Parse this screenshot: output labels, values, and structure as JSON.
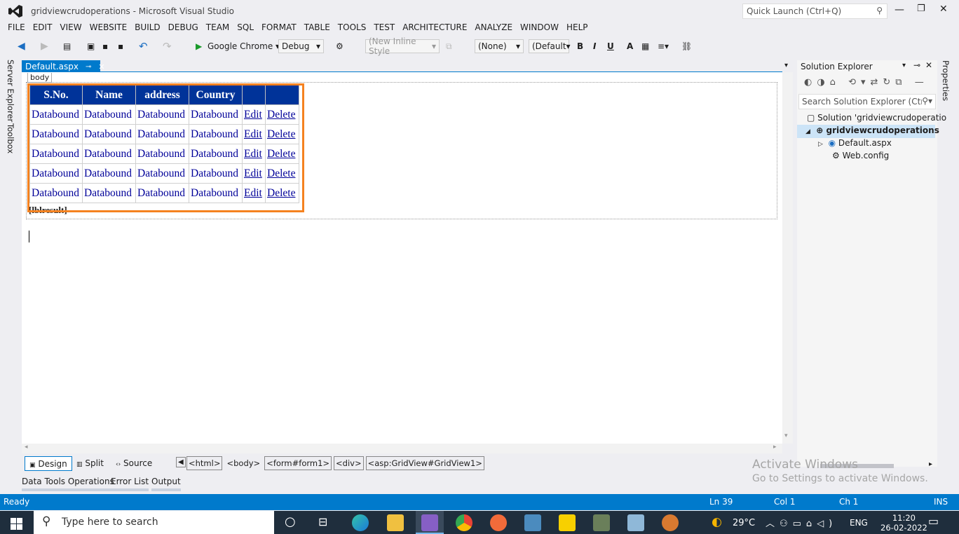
{
  "window": {
    "title": "gridviewcrudoperations - Microsoft Visual Studio",
    "quick_launch": "Quick Launch (Ctrl+Q)"
  },
  "menu": [
    "FILE",
    "EDIT",
    "VIEW",
    "WEBSITE",
    "BUILD",
    "DEBUG",
    "TEAM",
    "SQL",
    "FORMAT",
    "TABLE",
    "TOOLS",
    "TEST",
    "ARCHITECTURE",
    "ANALYZE",
    "WINDOW",
    "HELP"
  ],
  "toolbar": {
    "browser": "Google Chrome",
    "config": "Debug",
    "style": "(New Inline Style",
    "target": "(None)",
    "font": "(Default",
    "bold": "B",
    "italic": "I",
    "underline": "U"
  },
  "side_tabs": {
    "server_explorer": "Server Explorer",
    "toolbox": "Toolbox",
    "properties": "Properties"
  },
  "doc_tab": {
    "name": "Default.aspx",
    "pin": "⊸",
    "close": "✕"
  },
  "designer": {
    "body_tag": "body",
    "label_text": "[lblresult]"
  },
  "grid": {
    "headers": [
      "S.No.",
      "Name",
      "address",
      "Country",
      "",
      ""
    ],
    "rows": [
      [
        "Databound",
        "Databound",
        "Databound",
        "Databound",
        "Edit",
        "Delete"
      ],
      [
        "Databound",
        "Databound",
        "Databound",
        "Databound",
        "Edit",
        "Delete"
      ],
      [
        "Databound",
        "Databound",
        "Databound",
        "Databound",
        "Edit",
        "Delete"
      ],
      [
        "Databound",
        "Databound",
        "Databound",
        "Databound",
        "Edit",
        "Delete"
      ],
      [
        "Databound",
        "Databound",
        "Databound",
        "Databound",
        "Edit",
        "Delete"
      ]
    ]
  },
  "solution_explorer": {
    "title": "Solution Explorer",
    "search": "Search Solution Explorer (Ctrl-",
    "solution": "Solution 'gridviewcrudoperatio",
    "project": "gridviewcrudoperations",
    "files": [
      "Default.aspx",
      "Web.config"
    ]
  },
  "view_tabs": {
    "design": "Design",
    "split": "Split",
    "source": "Source"
  },
  "breadcrumbs": [
    "<html>",
    "<body>",
    "<form#form1>",
    "<div>",
    "<asp:GridView#GridView1>"
  ],
  "bottom_tabs": [
    "Data Tools Operations",
    "Error List",
    "Output"
  ],
  "activate": {
    "line1": "Activate Windows",
    "line2": "Go to Settings to activate Windows."
  },
  "status": {
    "ready": "Ready",
    "ln": "Ln 39",
    "col": "Col 1",
    "ch": "Ch 1",
    "mode": "INS"
  },
  "taskbar": {
    "search": "Type here to search",
    "weather": "29°C",
    "lang": "ENG",
    "time": "11:20",
    "date": "26-02-2022"
  },
  "colors": {
    "accent": "#007acc",
    "grid_header": "#003399",
    "highlight": "#f58220",
    "taskbar": "#1f2e3d"
  }
}
